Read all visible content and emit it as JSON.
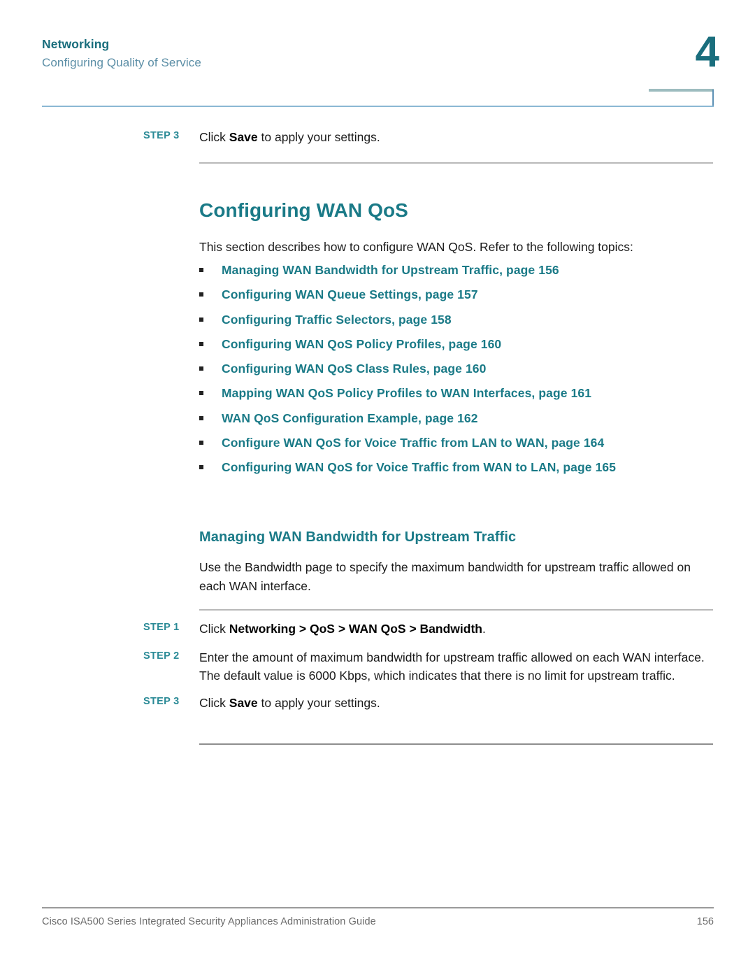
{
  "header": {
    "chapter_label": "Networking",
    "section_label": "Configuring Quality of Service",
    "chapter_number": "4"
  },
  "top_step": {
    "label": "STEP 3",
    "text_before": "Click ",
    "text_bold": "Save",
    "text_after": " to apply your settings."
  },
  "section": {
    "title": "Configuring WAN QoS",
    "intro": "This section describes how to configure WAN QoS. Refer to the following topics:"
  },
  "topics": [
    {
      "label": "Managing WAN Bandwidth for Upstream Traffic, page 156"
    },
    {
      "label": "Configuring WAN Queue Settings, page 157"
    },
    {
      "label": "Configuring Traffic Selectors, page 158"
    },
    {
      "label": "Configuring WAN QoS Policy Profiles, page 160"
    },
    {
      "label": "Configuring WAN QoS Class Rules, page 160"
    },
    {
      "label": "Mapping WAN QoS Policy Profiles to WAN Interfaces, page 161"
    },
    {
      "label": "WAN QoS Configuration Example, page 162"
    },
    {
      "label": "Configure WAN QoS for Voice Traffic from LAN to WAN, page 164"
    },
    {
      "label": "Configuring WAN QoS for Voice Traffic from WAN to LAN, page 165"
    }
  ],
  "subsection": {
    "title": "Managing WAN Bandwidth for Upstream Traffic",
    "body": "Use the Bandwidth page to specify the maximum bandwidth for upstream traffic allowed on each WAN interface."
  },
  "steps": [
    {
      "label": "STEP 1",
      "before": "Click ",
      "bold": "Networking > QoS > WAN QoS > Bandwidth",
      "after": "."
    },
    {
      "label": "STEP 2",
      "before": "Enter the amount of maximum bandwidth for upstream traffic allowed on each WAN interface. The default value is 6000 Kbps, which indicates that there is no limit for upstream traffic.",
      "bold": "",
      "after": ""
    },
    {
      "label": "STEP 3",
      "before": "Click ",
      "bold": "Save",
      "after": " to apply your settings."
    }
  ],
  "footer": {
    "text": "Cisco ISA500 Series Integrated Security Appliances Administration Guide",
    "page": "156"
  },
  "colors": {
    "teal": "#1a7a87",
    "teal_dark": "#1a6e7d",
    "step_teal": "#2a8a96",
    "subtitle_blue": "#5b8ea6",
    "rule_blue": "#8bb8d4",
    "rule_gray": "#b9b9b9",
    "footer_gray": "#6b6b6b"
  }
}
